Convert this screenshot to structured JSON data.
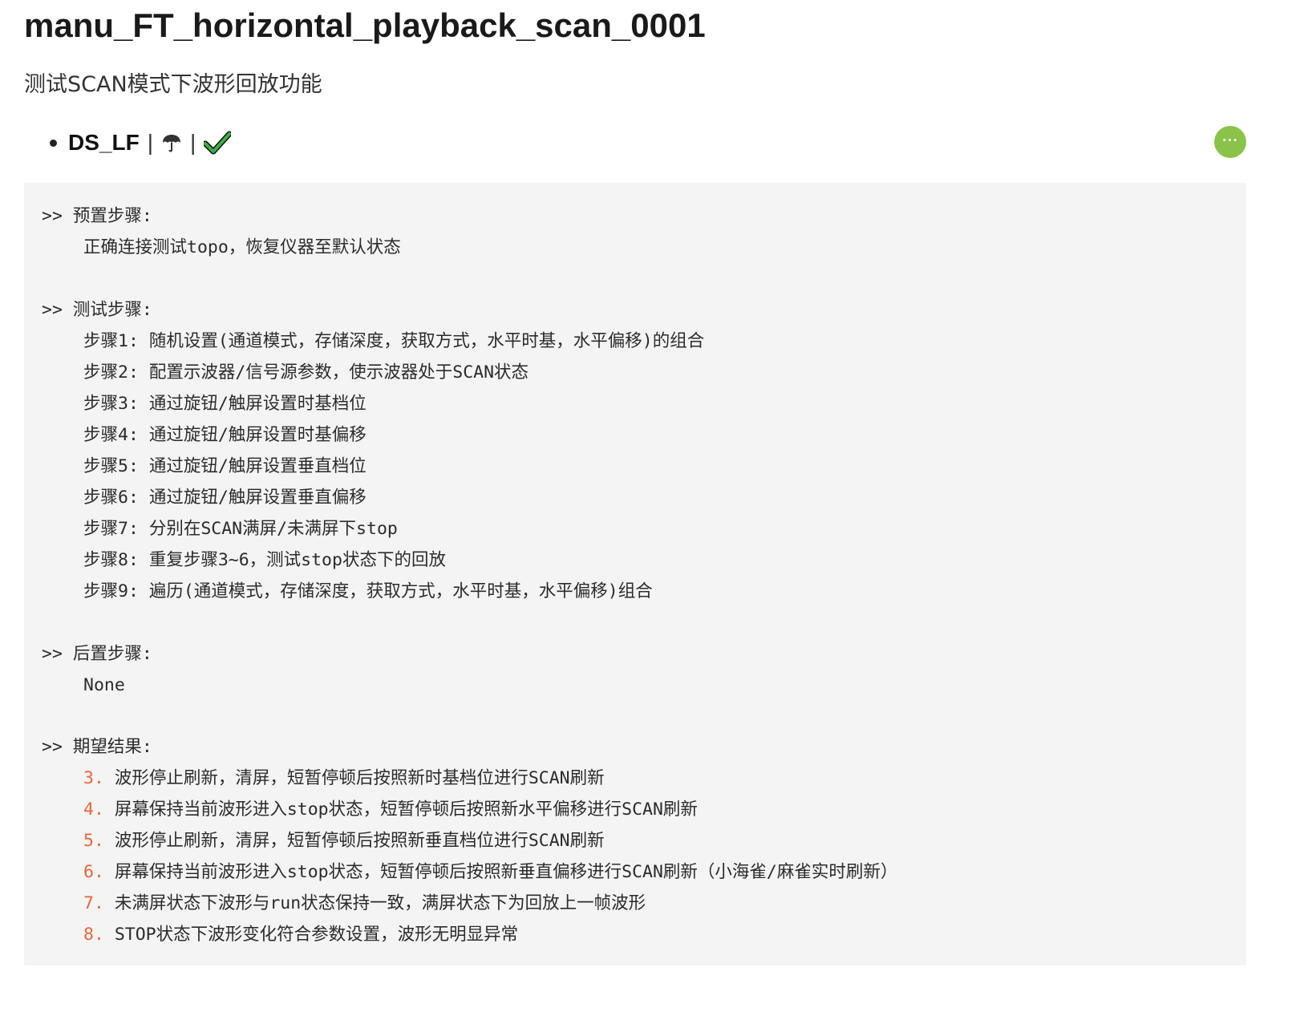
{
  "title": "manu_FT_horizontal_playback_scan_0001",
  "subtitle": "测试SCAN模式下波形回放功能",
  "meta": {
    "tag": "DS_LF",
    "separator": "|",
    "icons": [
      "umbrella-icon",
      "checkmark-icon"
    ],
    "check_color": "#3cb043"
  },
  "more_button": {
    "label": "···",
    "color": "#8bc34a"
  },
  "sections": {
    "preset": {
      "heading": ">> 预置步骤:",
      "lines": [
        "正确连接测试topo，恢复仪器至默认状态"
      ]
    },
    "test": {
      "heading": ">> 测试步骤:",
      "lines": [
        "步骤1: 随机设置(通道模式，存储深度，获取方式，水平时基，水平偏移)的组合",
        "步骤2: 配置示波器/信号源参数，使示波器处于SCAN状态",
        "步骤3: 通过旋钮/触屏设置时基档位",
        "步骤4: 通过旋钮/触屏设置时基偏移",
        "步骤5: 通过旋钮/触屏设置垂直档位",
        "步骤6: 通过旋钮/触屏设置垂直偏移",
        "步骤7: 分别在SCAN满屏/未满屏下stop",
        "步骤8: 重复步骤3~6，测试stop状态下的回放",
        "步骤9: 遍历(通道模式，存储深度，获取方式，水平时基，水平偏移)组合"
      ]
    },
    "post": {
      "heading": ">> 后置步骤:",
      "lines": [
        "None"
      ]
    },
    "expected": {
      "heading": ">> 期望结果:",
      "items": [
        {
          "num": "3.",
          "text": "波形停止刷新，清屏，短暂停顿后按照新时基档位进行SCAN刷新"
        },
        {
          "num": "4.",
          "text": "屏幕保持当前波形进入stop状态，短暂停顿后按照新水平偏移进行SCAN刷新"
        },
        {
          "num": "5.",
          "text": "波形停止刷新，清屏，短暂停顿后按照新垂直档位进行SCAN刷新"
        },
        {
          "num": "6.",
          "text": "屏幕保持当前波形进入stop状态，短暂停顿后按照新垂直偏移进行SCAN刷新（小海雀/麻雀实时刷新）"
        },
        {
          "num": "7.",
          "text": "未满屏状态下波形与run状态保持一致，满屏状态下为回放上一帧波形"
        },
        {
          "num": "8.",
          "text": "STOP状态下波形变化符合参数设置，波形无明显异常"
        }
      ],
      "number_color": "#e8663d"
    }
  }
}
